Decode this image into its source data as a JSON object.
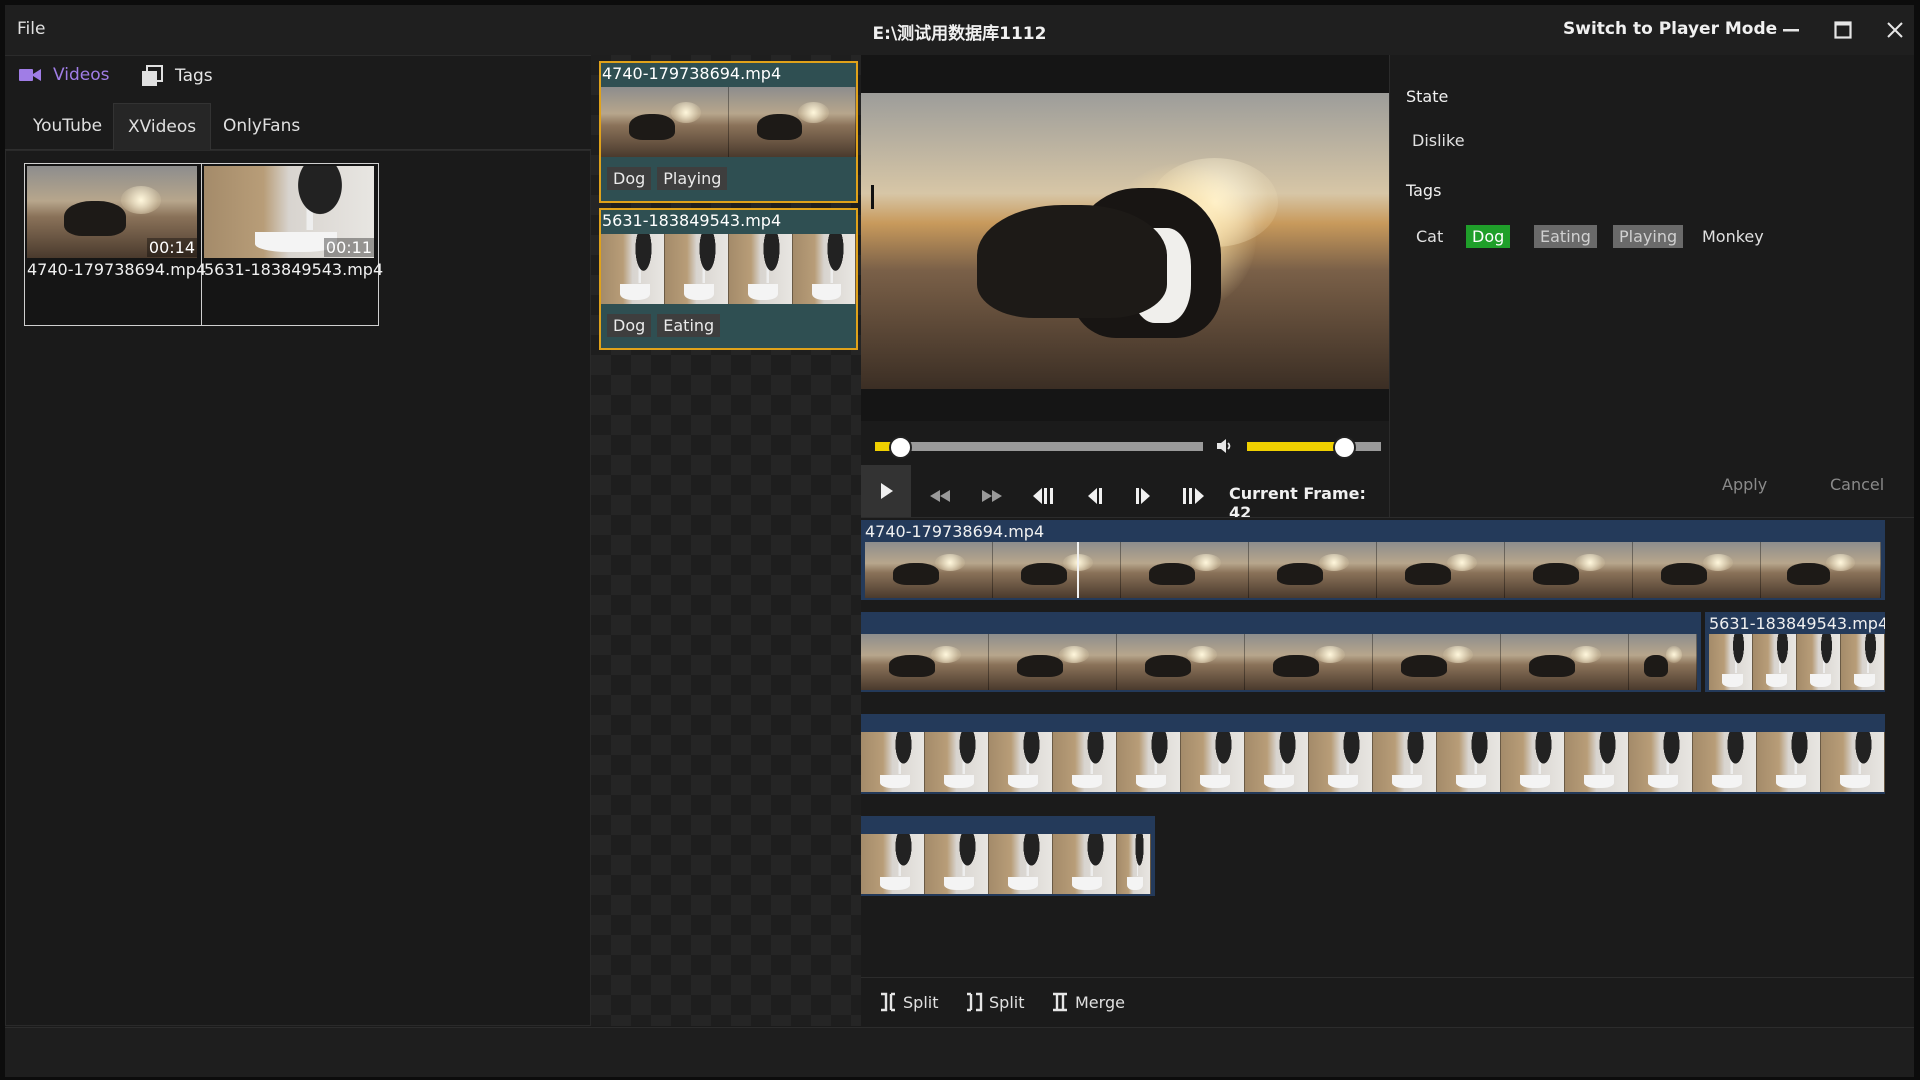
{
  "menu": {
    "file": "File"
  },
  "window": {
    "title": "E:\\测试用数据库1112",
    "switch_mode": "Switch to Player Mode"
  },
  "left": {
    "tabs": [
      {
        "label": "Videos",
        "icon": "video-camera-icon"
      },
      {
        "label": "Tags",
        "icon": "tags-icon"
      }
    ],
    "subtabs": [
      "YouTube",
      "XVideos",
      "OnlyFans"
    ],
    "active_subtab": "XVideos",
    "grid": [
      {
        "name": "4740-179738694.mp4",
        "duration": "00:14"
      },
      {
        "name": "5631-183849543.mp4",
        "duration": "00:11"
      }
    ]
  },
  "clips": [
    {
      "name": "4740-179738694.mp4",
      "tags": [
        "Dog",
        "Playing"
      ]
    },
    {
      "name": "5631-183849543.mp4",
      "tags": [
        "Dog",
        "Eating"
      ]
    }
  ],
  "player": {
    "current_frame": "Current Frame: 42",
    "progress": 0.07,
    "volume": 0.71
  },
  "panel": {
    "state_label": "State",
    "state_value": "Dislike",
    "tags_label": "Tags",
    "tags": [
      {
        "label": "Cat",
        "style": "plain"
      },
      {
        "label": "Dog",
        "style": "green"
      },
      {
        "label": "Eating",
        "style": "gray"
      },
      {
        "label": "Playing",
        "style": "gray"
      },
      {
        "label": "Monkey",
        "style": "plain"
      }
    ],
    "apply": "Apply",
    "cancel": "Cancel"
  },
  "timeline": {
    "track1_name": "4740-179738694.mp4",
    "track2_name": "5631-183849543.mp4"
  },
  "toolbar": {
    "split1": "Split",
    "split2": "Split",
    "merge": "Merge"
  },
  "colors": {
    "accent": "#e0a21a",
    "tag_green": "#1f9f2a",
    "track": "#243a5a",
    "slider": "#f0d000"
  }
}
